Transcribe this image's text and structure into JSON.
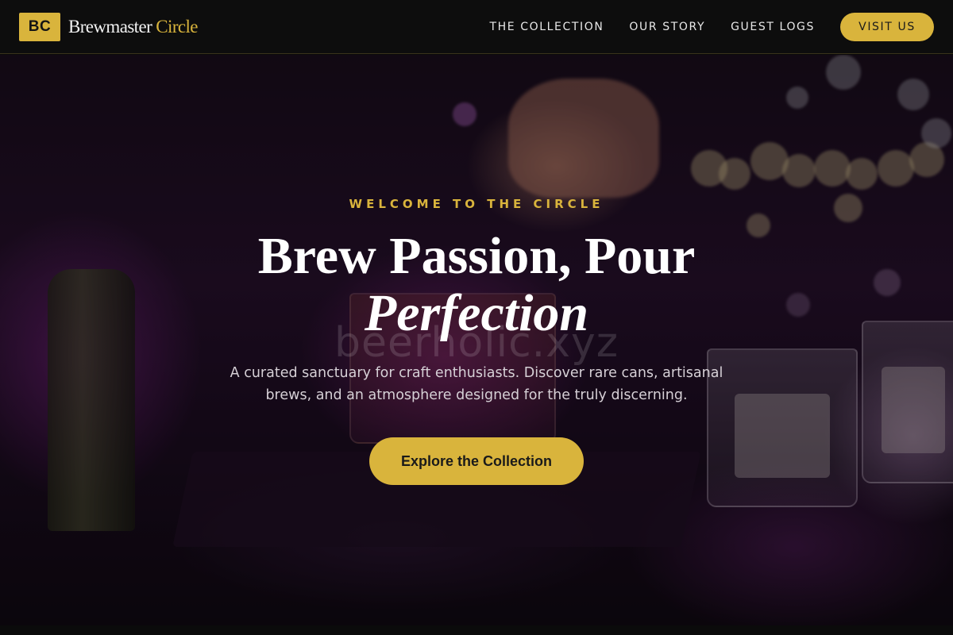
{
  "nav": {
    "badge": "BC",
    "brand_main": "Brewmaster",
    "brand_accent": "Circle",
    "links": [
      {
        "label": "THE COLLECTION"
      },
      {
        "label": "OUR STORY"
      },
      {
        "label": "GUEST LOGS"
      }
    ],
    "cta_label": "VISIT US"
  },
  "hero": {
    "eyebrow": "WELCOME TO THE CIRCLE",
    "headline_line1": "Brew Passion, Pour",
    "headline_line2": "Perfection",
    "watermark": "beerholic.xyz",
    "subtitle": "A curated sanctuary for craft enthusiasts. Discover rare cans, artisanal brews, and an atmosphere designed for the truly discerning.",
    "cta_label": "Explore the Collection"
  },
  "colors": {
    "accent": "#d9b43c",
    "nav_bg": "#0d0d0d",
    "text_light": "#ffffff"
  }
}
